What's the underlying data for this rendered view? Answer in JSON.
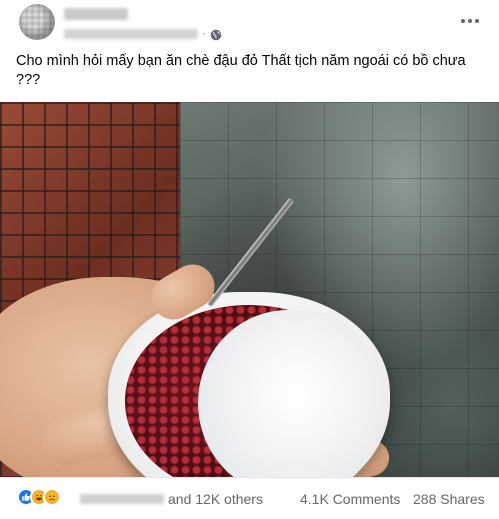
{
  "post": {
    "text": "Cho mình hỏi mấy bạn ăn chè đậu đỏ Thất tịch năm ngoái có bồ chưa ???",
    "meta_separator": "·"
  },
  "icons": {
    "privacy": "globe-icon",
    "menu": "more-icon",
    "reactions": [
      "like-icon",
      "haha-icon",
      "sad-icon"
    ]
  },
  "reactions_summary": {
    "others_text": "and 12K others",
    "comments_text": "4.1K Comments",
    "shares_text": "288 Shares"
  },
  "colors": {
    "like": "#1877f2",
    "emoji": "#f7b125",
    "secondary_text": "#65676b"
  }
}
